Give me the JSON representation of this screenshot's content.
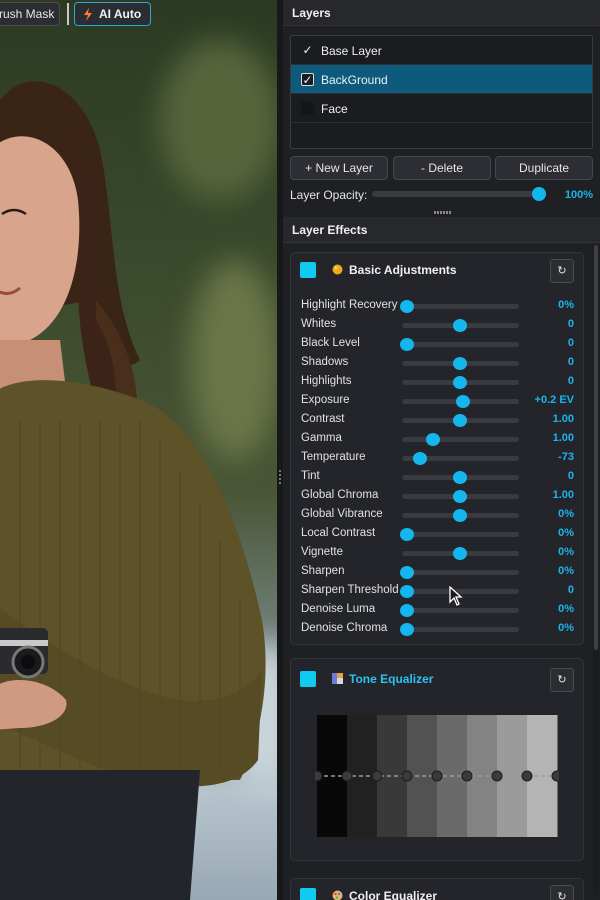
{
  "toolbar": {
    "brush_mask_label": "rush Mask",
    "ai_auto_label": "AI Auto"
  },
  "layers": {
    "title": "Layers",
    "items": [
      {
        "label": "Base Layer",
        "checked": true,
        "selected": false
      },
      {
        "label": "BackGround",
        "checked": true,
        "selected": true
      },
      {
        "label": "Face",
        "checked": false,
        "selected": false
      }
    ],
    "buttons": {
      "new": "+ New Layer",
      "delete": "- Delete",
      "duplicate": "Duplicate"
    },
    "opacity": {
      "label": "Layer Opacity:",
      "value_text": "100%",
      "fraction": 1.0
    }
  },
  "effects": {
    "title": "Layer Effects",
    "basic": {
      "title": "Basic Adjustments",
      "reset_icon": "reset-icon",
      "sliders": [
        {
          "name": "Highlight Recovery",
          "value": "0%",
          "pos": 0.0
        },
        {
          "name": "Whites",
          "value": "0",
          "pos": 0.5
        },
        {
          "name": "Black Level",
          "value": "0",
          "pos": 0.0
        },
        {
          "name": "Shadows",
          "value": "0",
          "pos": 0.5
        },
        {
          "name": "Highlights",
          "value": "0",
          "pos": 0.5
        },
        {
          "name": "Exposure",
          "value": "+0.2 EV",
          "pos": 0.53
        },
        {
          "name": "Contrast",
          "value": "1.00",
          "pos": 0.5
        },
        {
          "name": "Gamma",
          "value": "1.00",
          "pos": 0.25
        },
        {
          "name": "Temperature",
          "value": "-73",
          "pos": 0.12
        },
        {
          "name": "Tint",
          "value": "0",
          "pos": 0.5
        },
        {
          "name": "Global Chroma",
          "value": "1.00",
          "pos": 0.5
        },
        {
          "name": "Global Vibrance",
          "value": "0%",
          "pos": 0.5
        },
        {
          "name": "Local Contrast",
          "value": "0%",
          "pos": 0.0
        },
        {
          "name": "Vignette",
          "value": "0%",
          "pos": 0.5
        },
        {
          "name": "Sharpen",
          "value": "0%",
          "pos": 0.0
        },
        {
          "name": "Sharpen Threshold",
          "value": "0",
          "pos": 0.0
        },
        {
          "name": "Denoise Luma",
          "value": "0%",
          "pos": 0.0
        },
        {
          "name": "Denoise Chroma",
          "value": "0%",
          "pos": 0.0
        }
      ]
    },
    "tone": {
      "title": "Tone Equalizer",
      "points": 9,
      "levels": [
        0.5,
        0.5,
        0.5,
        0.5,
        0.5,
        0.5,
        0.5,
        0.5,
        0.5
      ]
    },
    "color": {
      "title": "Color Equalizer"
    }
  },
  "colors": {
    "accent": "#14b6ee",
    "selected_row": "#0d5a7d",
    "swatch": "#0fcbf0"
  }
}
